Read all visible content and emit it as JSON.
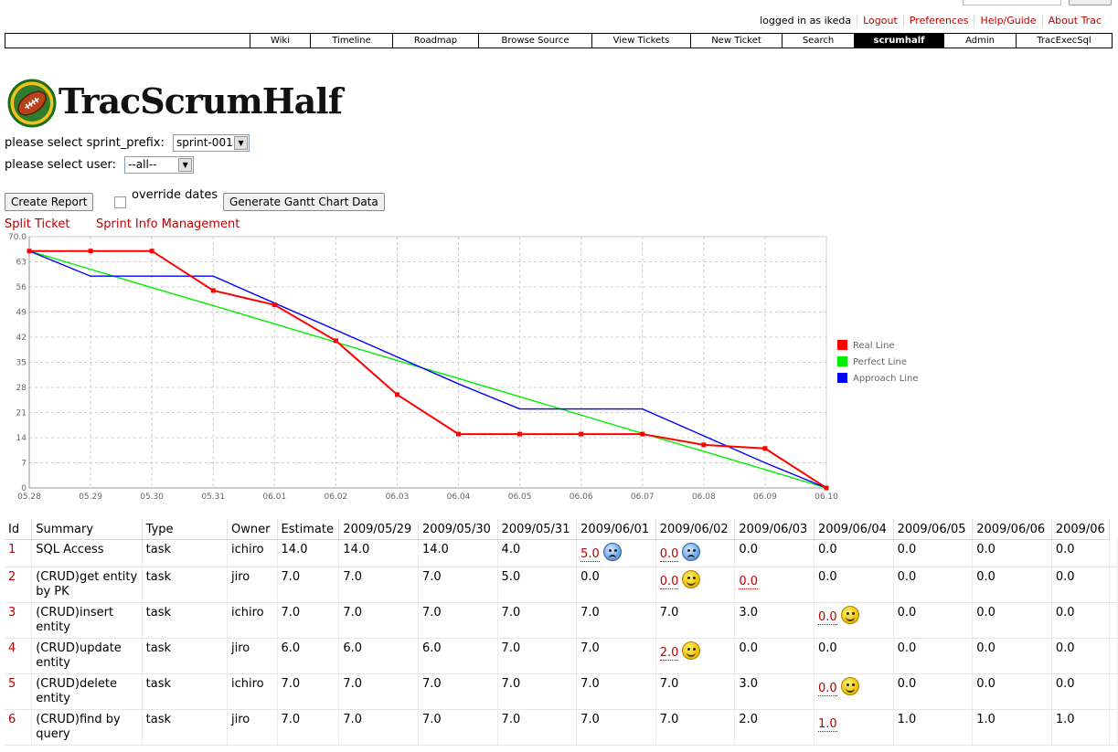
{
  "metanav": {
    "logged_in": "logged in as ikeda",
    "logout": "Logout",
    "preferences": "Preferences",
    "help": "Help/Guide",
    "about": "About Trac"
  },
  "mainnav": [
    "Wiki",
    "Timeline",
    "Roadmap",
    "Browse Source",
    "View Tickets",
    "New Ticket",
    "Search",
    "scrumhalf",
    "Admin",
    "TracExecSql"
  ],
  "logo_text": "TracScrumHalf",
  "form": {
    "sprint_label": "please select sprint_prefix:",
    "sprint_value": "sprint-001",
    "user_label": "please select user:",
    "user_value": "--all--",
    "create_report": "Create Report",
    "override_dates": "override dates",
    "override_checked": false,
    "gantt": "Generate Gantt Chart Data"
  },
  "links": {
    "split_ticket": "Split Ticket",
    "sprint_info": "Sprint Info Management"
  },
  "chart_data": {
    "type": "line",
    "x": [
      "05.28",
      "05.29",
      "05.30",
      "05.31",
      "06.01",
      "06.02",
      "06.03",
      "06.04",
      "06.05",
      "06.06",
      "06.07",
      "06.08",
      "06.09",
      "06.10"
    ],
    "ylim": [
      0,
      70
    ],
    "yticks": [
      "0",
      "7",
      "14",
      "21",
      "28",
      "35",
      "42",
      "49",
      "56",
      "63",
      "70.0"
    ],
    "grid": true,
    "legend_position": "right",
    "series": [
      {
        "name": "Real Line",
        "color": "#ff0000",
        "values": [
          66,
          66,
          66,
          55,
          51,
          41,
          26,
          15,
          15,
          15,
          15,
          12,
          11,
          0
        ]
      },
      {
        "name": "Perfect Line",
        "color": "#00ee00",
        "values": [
          66,
          60.9,
          55.8,
          50.8,
          45.7,
          40.6,
          35.5,
          30.5,
          25.4,
          20.3,
          15.2,
          10.2,
          5.1,
          0
        ]
      },
      {
        "name": "Approach Line",
        "color": "#0000ff",
        "values": [
          66,
          59,
          59,
          59,
          51.5,
          44,
          36.5,
          29,
          22,
          22,
          22,
          14.5,
          7,
          0
        ]
      }
    ]
  },
  "table": {
    "headers": [
      "Id",
      "Summary",
      "Type",
      "Owner",
      "Estimate",
      "2009/05/29",
      "2009/05/30",
      "2009/05/31",
      "2009/06/01",
      "2009/06/02",
      "2009/06/03",
      "2009/06/04",
      "2009/06/05",
      "2009/06/06",
      "2009/06"
    ],
    "rows": [
      {
        "id": "1",
        "summary": "SQL Access",
        "type": "task",
        "owner": "ichiro",
        "estimate": "14.0",
        "days": [
          {
            "v": "14.0"
          },
          {
            "v": "14.0"
          },
          {
            "v": "4.0"
          },
          {
            "v": "5.0",
            "changed": true,
            "face": "sad"
          },
          {
            "v": "0.0",
            "changed": true,
            "face": "sad"
          },
          {
            "v": "0.0"
          },
          {
            "v": "0.0"
          },
          {
            "v": "0.0"
          },
          {
            "v": "0.0"
          },
          {
            "v": "0.0"
          }
        ]
      },
      {
        "id": "2",
        "summary": "(CRUD)get entity by PK",
        "type": "task",
        "owner": "jiro",
        "estimate": "7.0",
        "days": [
          {
            "v": "7.0"
          },
          {
            "v": "7.0"
          },
          {
            "v": "5.0"
          },
          {
            "v": "0.0"
          },
          {
            "v": "0.0",
            "changed": true,
            "face": "happy"
          },
          {
            "v": "0.0",
            "changed": true
          },
          {
            "v": "0.0"
          },
          {
            "v": "0.0"
          },
          {
            "v": "0.0"
          },
          {
            "v": "0.0"
          }
        ]
      },
      {
        "id": "3",
        "summary": "(CRUD)insert entity",
        "type": "task",
        "owner": "ichiro",
        "estimate": "7.0",
        "days": [
          {
            "v": "7.0"
          },
          {
            "v": "7.0"
          },
          {
            "v": "7.0"
          },
          {
            "v": "7.0"
          },
          {
            "v": "7.0"
          },
          {
            "v": "3.0"
          },
          {
            "v": "0.0",
            "changed": true,
            "face": "happy"
          },
          {
            "v": "0.0"
          },
          {
            "v": "0.0"
          },
          {
            "v": "0.0"
          }
        ]
      },
      {
        "id": "4",
        "summary": "(CRUD)update entity",
        "type": "task",
        "owner": "jiro",
        "estimate": "6.0",
        "days": [
          {
            "v": "6.0"
          },
          {
            "v": "6.0"
          },
          {
            "v": "7.0"
          },
          {
            "v": "7.0"
          },
          {
            "v": "2.0",
            "changed": true,
            "face": "happy"
          },
          {
            "v": "0.0"
          },
          {
            "v": "0.0"
          },
          {
            "v": "0.0"
          },
          {
            "v": "0.0"
          },
          {
            "v": "0.0"
          }
        ]
      },
      {
        "id": "5",
        "summary": "(CRUD)delete entity",
        "type": "task",
        "owner": "ichiro",
        "estimate": "7.0",
        "days": [
          {
            "v": "7.0"
          },
          {
            "v": "7.0"
          },
          {
            "v": "7.0"
          },
          {
            "v": "7.0"
          },
          {
            "v": "7.0"
          },
          {
            "v": "3.0"
          },
          {
            "v": "0.0",
            "changed": true,
            "face": "happy"
          },
          {
            "v": "0.0"
          },
          {
            "v": "0.0"
          },
          {
            "v": "0.0"
          }
        ]
      },
      {
        "id": "6",
        "summary": "(CRUD)find by query",
        "type": "task",
        "owner": "jiro",
        "estimate": "7.0",
        "days": [
          {
            "v": "7.0"
          },
          {
            "v": "7.0"
          },
          {
            "v": "7.0"
          },
          {
            "v": "7.0"
          },
          {
            "v": "7.0"
          },
          {
            "v": "2.0"
          },
          {
            "v": "1.0",
            "changed": true
          },
          {
            "v": "1.0"
          },
          {
            "v": "1.0"
          },
          {
            "v": "1.0"
          }
        ]
      }
    ]
  }
}
